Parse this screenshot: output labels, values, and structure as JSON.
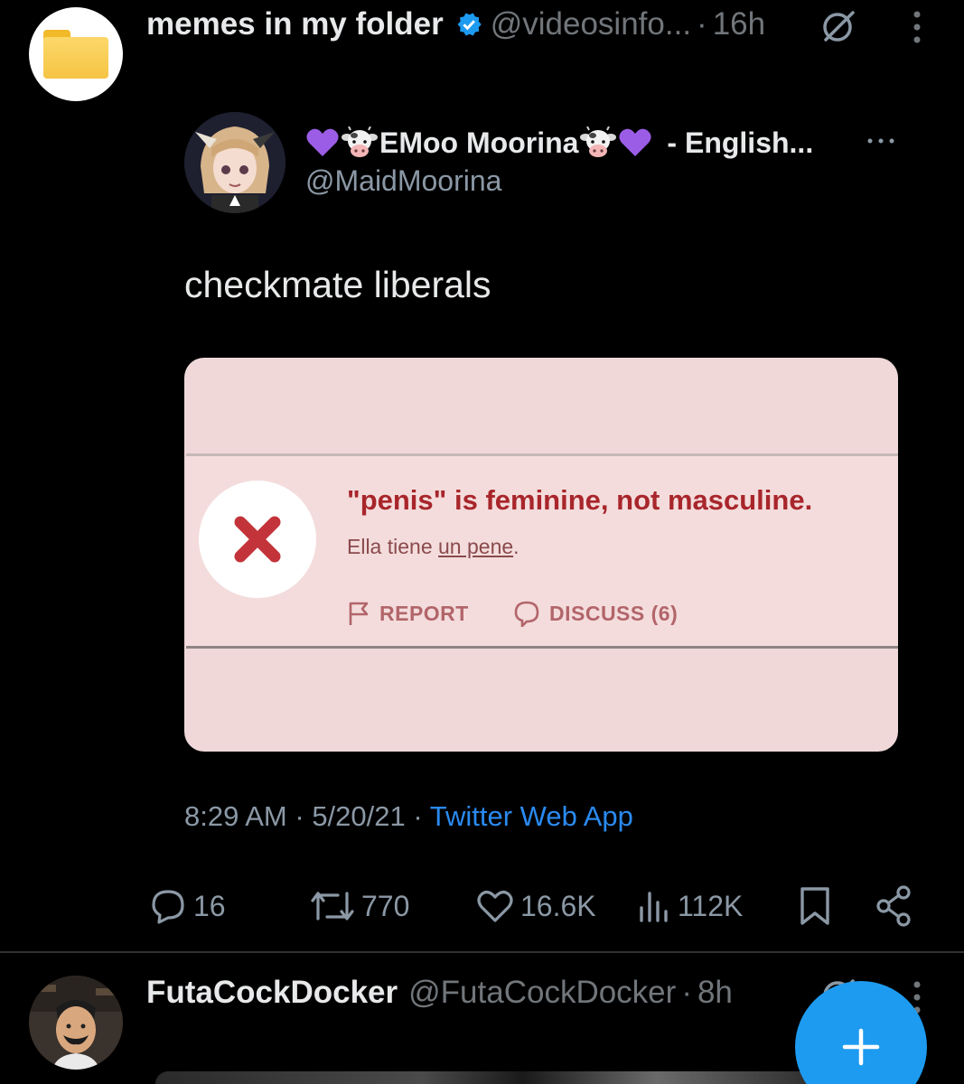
{
  "post": {
    "author_name": "memes in my folder",
    "handle": "@videosinfo...",
    "time": "16h",
    "separator": "·"
  },
  "quoted": {
    "name": "EMoo Moorina",
    "name_suffix": "- English...",
    "handle": "@MaidMoorina",
    "text": "checkmate liberals",
    "card": {
      "error_title": "\"penis\" is feminine, not masculine.",
      "sentence_start": "Ella tiene ",
      "sentence_underlined": "un pene",
      "sentence_end": ".",
      "report_label": "REPORT",
      "discuss_label": "DISCUSS (6)"
    },
    "meta": {
      "time": "8:29 AM",
      "date": "5/20/21",
      "separator": " · ",
      "app": "Twitter Web App"
    }
  },
  "stats": {
    "replies": "16",
    "retweets": "770",
    "likes": "16.6K",
    "views": "112K"
  },
  "next_post": {
    "author_name": "FutaCockDocker",
    "handle": "@FutaCockDocker",
    "time": "8h",
    "separator": "·"
  },
  "icons": {
    "verified": "verified-badge-icon",
    "grok": "grok-icon",
    "more": "more-vertical-icon",
    "reply": "reply-icon",
    "retweet": "retweet-icon",
    "like": "heart-icon",
    "views": "views-icon",
    "bookmark": "bookmark-icon",
    "share": "share-icon",
    "compose": "plus-icon"
  },
  "colors": {
    "accent": "#1d9bf0",
    "link": "#2a8af0",
    "muted": "#71767b",
    "error_red": "#a8262b",
    "card_bg": "#f0d8d8"
  }
}
